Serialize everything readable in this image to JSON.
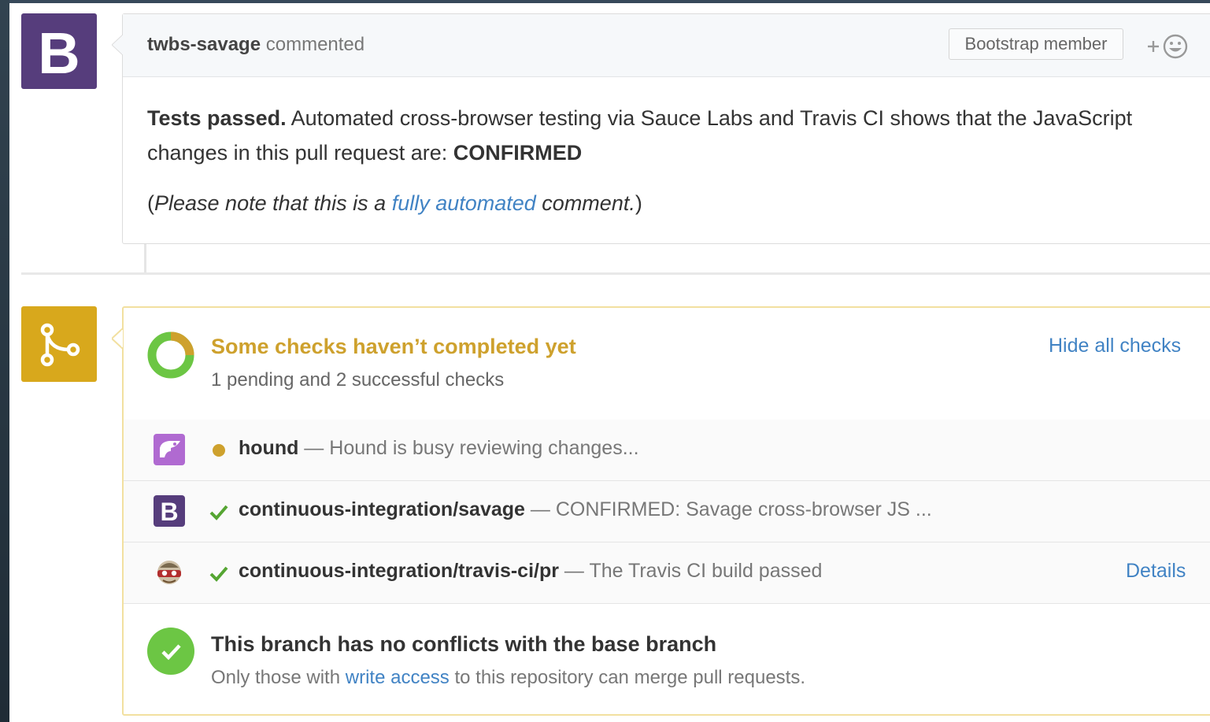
{
  "comment": {
    "author": "twbs-savage",
    "verb": "commented",
    "badge": "Bootstrap member",
    "reaction_icon": "add-reaction-smiley-icon",
    "avatar_letter": "B",
    "body": {
      "bold_lead": "Tests passed.",
      "text": " Automated cross-browser testing via Sauce Labs and Travis CI shows that the JavaScript changes in this pull request are: ",
      "status": "CONFIRMED",
      "note_open": "(",
      "note_pre": "Please note that this is a ",
      "note_link": "fully automated",
      "note_post": " comment.",
      "note_close": ")"
    }
  },
  "checks": {
    "title": "Some checks haven’t completed yet",
    "subtitle": "1 pending and 2 successful checks",
    "toggle_label": "Hide all checks",
    "accent_color": "#cea12d",
    "items": [
      {
        "name": "hound",
        "separator": " — ",
        "description": "Hound is busy reviewing changes...",
        "state": "pending",
        "icon": "hound-icon"
      },
      {
        "name": "continuous-integration/savage",
        "separator": " — ",
        "description": "CONFIRMED: Savage cross-browser JS ...",
        "state": "success",
        "icon": "bootstrap-icon"
      },
      {
        "name": "continuous-integration/travis-ci/pr",
        "separator": " — ",
        "description": "The Travis CI build passed",
        "state": "success",
        "icon": "travis-ci-icon",
        "details_label": "Details"
      }
    ]
  },
  "merge": {
    "title": "This branch has no conflicts with the base branch",
    "subtitle_pre": "Only those with ",
    "subtitle_link": "write access",
    "subtitle_post": " to this repository can merge pull requests.",
    "success_color": "#6cc644"
  }
}
